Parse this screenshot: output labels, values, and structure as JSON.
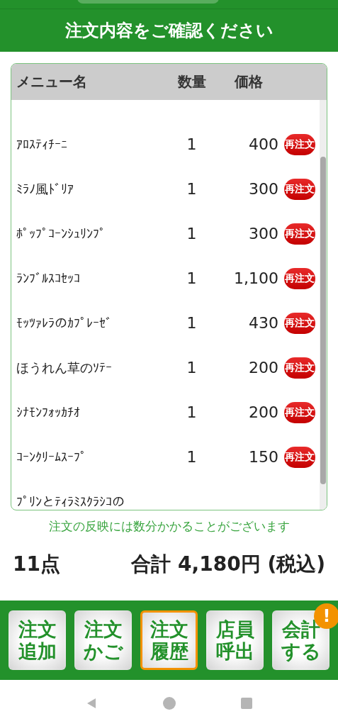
{
  "header": {
    "title": "注文内容をご確認ください"
  },
  "table": {
    "columns": [
      "メニュー名",
      "数量",
      "価格"
    ],
    "rows": [
      {
        "name": "ｱﾛｽﾃｨﾁｰﾆ",
        "qty": "1",
        "price": "400",
        "action": "再注文"
      },
      {
        "name": "ﾐﾗﾉ風ﾄﾞﾘｱ",
        "qty": "1",
        "price": "300",
        "action": "再注文"
      },
      {
        "name": "ﾎﾟｯﾌﾟｺｰﾝｼｭﾘﾝﾌﾟ",
        "qty": "1",
        "price": "300",
        "action": "再注文"
      },
      {
        "name": "ﾗﾝﾌﾞﾙｽｺｾｯｺ",
        "qty": "1",
        "price": "1,100",
        "action": "再注文"
      },
      {
        "name": "ﾓｯﾂｧﾚﾗのｶﾌﾟﾚｰｾﾞ",
        "qty": "1",
        "price": "430",
        "action": "再注文"
      },
      {
        "name": "ほうれん草のｿﾃｰ",
        "qty": "1",
        "price": "200",
        "action": "再注文"
      },
      {
        "name": "ｼﾅﾓﾝﾌｫｯｶﾁｵ",
        "qty": "1",
        "price": "200",
        "action": "再注文"
      },
      {
        "name": "ｺｰﾝｸﾘｰﾑｽｰﾌﾟ",
        "qty": "1",
        "price": "150",
        "action": "再注文"
      },
      {
        "name": "ﾌﾟﾘﾝとﾃｨﾗﾐｽｸﾗｼｺの"
      }
    ]
  },
  "note": "注文の反映には数分かかることがございます",
  "summary": {
    "count": "11点",
    "total": "合計 4,180円 (税込)"
  },
  "nav_buttons": [
    {
      "label": "注文追加",
      "selected": false
    },
    {
      "label": "注文かご",
      "selected": false
    },
    {
      "label": "注文履歴",
      "selected": true
    },
    {
      "label": "店員呼出",
      "selected": false
    },
    {
      "label": "会計する",
      "selected": false,
      "badge": "!"
    }
  ]
}
